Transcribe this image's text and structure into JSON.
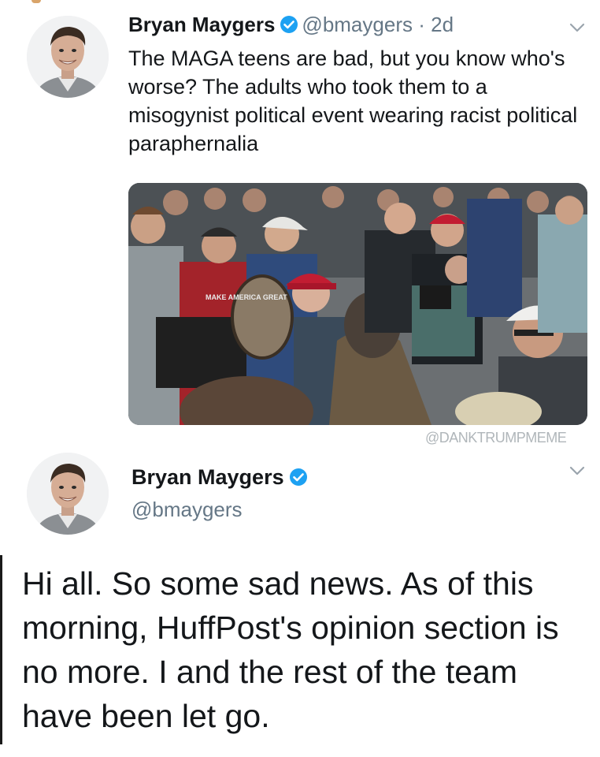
{
  "tweet1": {
    "author_name": "Bryan Maygers",
    "handle": "@bmaygers",
    "separator": "·",
    "timestamp": "2d",
    "text": "The MAGA teens are bad, but you know who's worse? The adults who took them to a misogynist political event wearing racist political paraphernalia",
    "media_caption_on_cap": "MAKE AMERICA GREAT"
  },
  "watermark": "@DANKTRUMPMEME",
  "tweet2": {
    "author_name": "Bryan Maygers",
    "handle": "@bmaygers",
    "text": "Hi all. So some sad news. As of this morning, HuffPost's opinion section is no more. I and the rest of the team have been let go."
  },
  "colors": {
    "verified_blue": "#1da1f2",
    "secondary_text": "#657786",
    "primary_text": "#14171a"
  },
  "icons": {
    "verified": "verified-badge-icon",
    "more": "chevron-down-icon"
  }
}
